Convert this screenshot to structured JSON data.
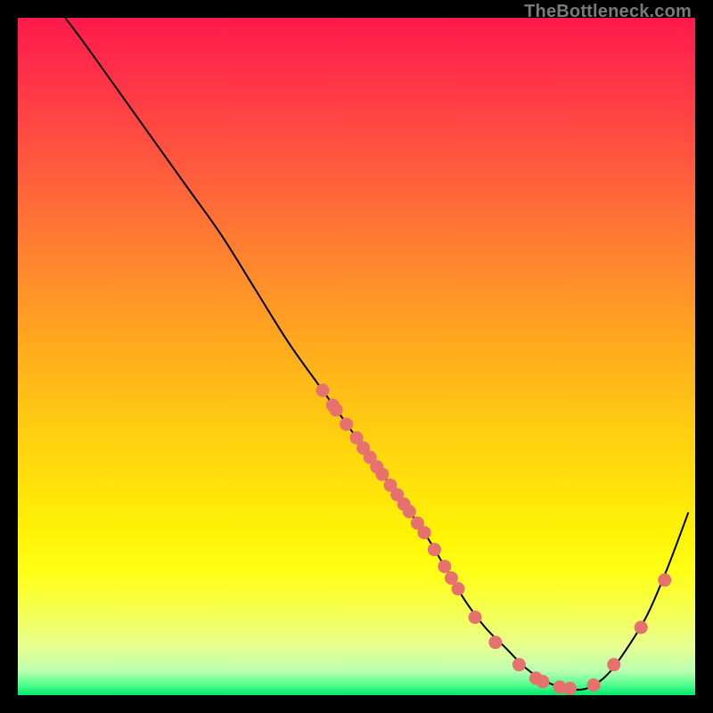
{
  "watermark": "TheBottleneck.com",
  "chart_data": {
    "type": "line",
    "title": "",
    "xlabel": "",
    "ylabel": "",
    "xlim": [
      0,
      100
    ],
    "ylim": [
      0,
      100
    ],
    "grid": false,
    "series": [
      {
        "name": "curve",
        "x": [
          7,
          10,
          15,
          20,
          25,
          30,
          35,
          40,
          45,
          50,
          55,
          60,
          63,
          66,
          69,
          72,
          75,
          78,
          81,
          84,
          87,
          90,
          93,
          96,
          99
        ],
        "y": [
          100,
          96,
          89,
          82,
          75,
          68,
          60,
          52,
          45,
          38,
          31,
          24,
          19,
          14,
          10,
          7,
          4,
          2,
          1,
          1,
          3,
          7,
          12,
          19,
          27
        ]
      }
    ],
    "scatter": [
      {
        "x": 45.0,
        "y": 45.0
      },
      {
        "x": 46.5,
        "y": 42.8
      },
      {
        "x": 47.0,
        "y": 42.1
      },
      {
        "x": 48.5,
        "y": 40.0
      },
      {
        "x": 50.0,
        "y": 38.0
      },
      {
        "x": 51.0,
        "y": 36.5
      },
      {
        "x": 52.0,
        "y": 35.1
      },
      {
        "x": 53.0,
        "y": 33.7
      },
      {
        "x": 53.8,
        "y": 32.6
      },
      {
        "x": 55.0,
        "y": 31.0
      },
      {
        "x": 56.0,
        "y": 29.6
      },
      {
        "x": 57.0,
        "y": 28.2
      },
      {
        "x": 57.8,
        "y": 27.1
      },
      {
        "x": 59.0,
        "y": 25.4
      },
      {
        "x": 60.0,
        "y": 24.0
      },
      {
        "x": 61.5,
        "y": 21.5
      },
      {
        "x": 63.0,
        "y": 19.0
      },
      {
        "x": 64.0,
        "y": 17.3
      },
      {
        "x": 65.0,
        "y": 15.7
      },
      {
        "x": 67.5,
        "y": 11.5
      },
      {
        "x": 70.5,
        "y": 7.8
      },
      {
        "x": 74.0,
        "y": 4.5
      },
      {
        "x": 76.5,
        "y": 2.5
      },
      {
        "x": 77.5,
        "y": 2.0
      },
      {
        "x": 80.0,
        "y": 1.2
      },
      {
        "x": 81.5,
        "y": 1.0
      },
      {
        "x": 85.0,
        "y": 1.5
      },
      {
        "x": 88.0,
        "y": 4.5
      },
      {
        "x": 92.0,
        "y": 10.0
      },
      {
        "x": 95.5,
        "y": 17.0
      }
    ],
    "gradient_stops": [
      {
        "t": 0.0,
        "c": "#ff1a4b"
      },
      {
        "t": 0.06,
        "c": "#ff2a4a"
      },
      {
        "t": 0.14,
        "c": "#ff4244"
      },
      {
        "t": 0.22,
        "c": "#ff5a3d"
      },
      {
        "t": 0.3,
        "c": "#ff7335"
      },
      {
        "t": 0.38,
        "c": "#ff8c2c"
      },
      {
        "t": 0.46,
        "c": "#ffa321"
      },
      {
        "t": 0.54,
        "c": "#ffba18"
      },
      {
        "t": 0.62,
        "c": "#ffd010"
      },
      {
        "t": 0.7,
        "c": "#ffe40a"
      },
      {
        "t": 0.76,
        "c": "#fff305"
      },
      {
        "t": 0.82,
        "c": "#feff17"
      },
      {
        "t": 0.88,
        "c": "#f4ff55"
      },
      {
        "t": 0.93,
        "c": "#e6ff92"
      },
      {
        "t": 0.965,
        "c": "#b9ffb1"
      },
      {
        "t": 0.985,
        "c": "#4fff8d"
      },
      {
        "t": 1.0,
        "c": "#00e86b"
      }
    ],
    "point_color": "#e6716e",
    "line_color": "#000000"
  }
}
